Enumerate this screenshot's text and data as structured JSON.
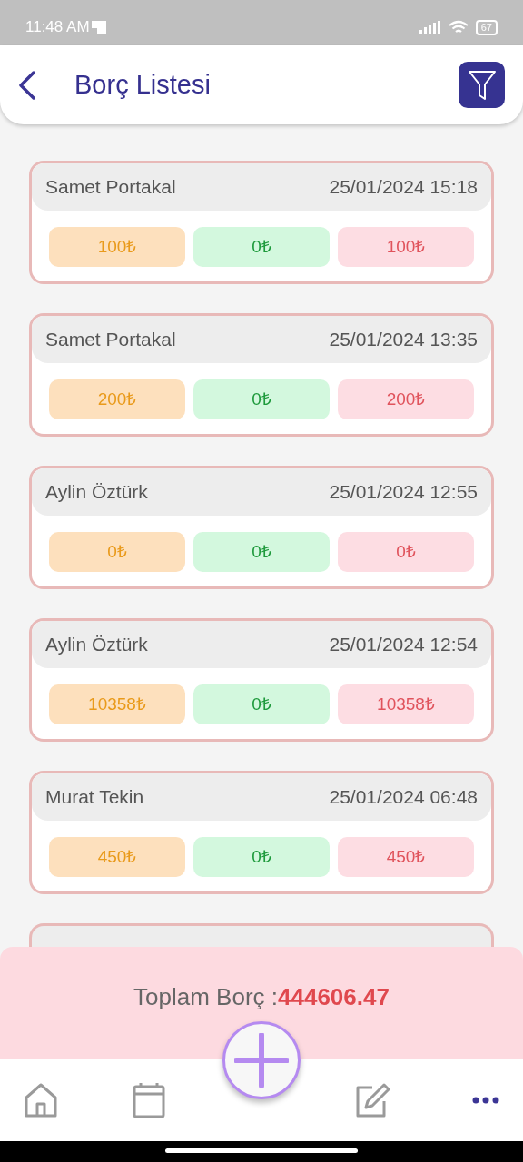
{
  "status_bar": {
    "time": "11:48 AM",
    "battery": "67"
  },
  "header": {
    "title": "Borç Listesi"
  },
  "debts": [
    {
      "name": "Samet Portakal",
      "date": "25/01/2024 15:18",
      "amounts": [
        "100₺",
        "0₺",
        "100₺"
      ]
    },
    {
      "name": "Samet Portakal",
      "date": "25/01/2024 13:35",
      "amounts": [
        "200₺",
        "0₺",
        "200₺"
      ]
    },
    {
      "name": "Aylin Öztürk",
      "date": "25/01/2024 12:55",
      "amounts": [
        "0₺",
        "0₺",
        "0₺"
      ]
    },
    {
      "name": "Aylin Öztürk",
      "date": "25/01/2024 12:54",
      "amounts": [
        "10358₺",
        "0₺",
        "10358₺"
      ]
    },
    {
      "name": "Murat Tekin",
      "date": "25/01/2024 06:48",
      "amounts": [
        "450₺",
        "0₺",
        "450₺"
      ]
    }
  ],
  "total": {
    "label": "Toplam Borç :",
    "value": "444606.47"
  },
  "bottom_nav": [
    {
      "kind": "home",
      "selected": false
    },
    {
      "kind": "calendar",
      "selected": false
    },
    {
      "kind": "add",
      "selected": false
    },
    {
      "kind": "edit",
      "selected": false
    },
    {
      "kind": "more",
      "selected": true
    }
  ]
}
